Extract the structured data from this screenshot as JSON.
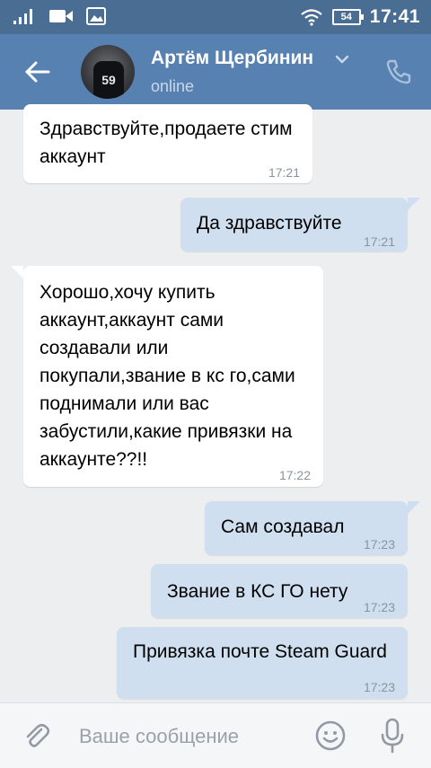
{
  "status_bar": {
    "battery": "54",
    "time": "17:41",
    "icons": [
      "signal-icon",
      "video-icon",
      "image-icon",
      "wifi-icon",
      "battery-icon"
    ]
  },
  "header": {
    "name": "Артём Щербинин",
    "status": "online",
    "avatar_text": "59",
    "icons": [
      "back-arrow-icon",
      "chevron-down-icon",
      "phone-icon"
    ]
  },
  "messages": [
    {
      "dir": "in",
      "text": "Здравствуйте,продаете стим аккаунт",
      "time": "17:21"
    },
    {
      "dir": "out",
      "text": "Да здравствуйте",
      "time": "17:21"
    },
    {
      "dir": "in",
      "text": "Хорошо,хочу купить аккаунт,аккаунт сами создавали или покупали,звание в кс го,сами поднимали или вас забустили,какие привязки на аккаунте??!!",
      "time": "17:22"
    },
    {
      "dir": "out",
      "text": "Сам создавал",
      "time": "17:23"
    },
    {
      "dir": "out",
      "text": "Звание в КС ГО нету",
      "time": "17:23"
    },
    {
      "dir": "out",
      "text": "Привязка почте Steam Guard",
      "time": "17:23"
    }
  ],
  "input": {
    "placeholder": "Ваше сообщение",
    "icons": [
      "paperclip-icon",
      "emoji-icon",
      "microphone-icon"
    ]
  },
  "colors": {
    "status_bar": "#4a6d93",
    "header": "#5781b1",
    "background": "#edeef0",
    "incoming_bubble": "#ffffff",
    "outgoing_bubble": "#cfdfef"
  }
}
